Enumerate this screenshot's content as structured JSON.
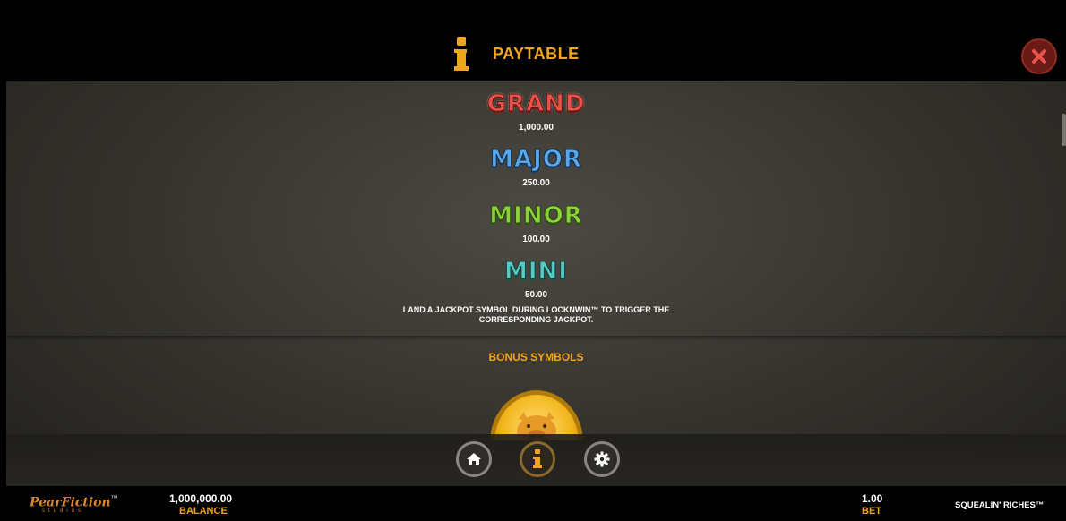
{
  "top_menu_icon": "ellipsis-icon",
  "header": {
    "title": "PAYTABLE",
    "info_icon": "info-icon",
    "close_icon": "close-icon"
  },
  "jackpots": [
    {
      "name": "GRAND",
      "value": "1,000.00",
      "color": "#e8524a"
    },
    {
      "name": "MAJOR",
      "value": "250.00",
      "color": "#5aa7e8"
    },
    {
      "name": "MINOR",
      "value": "100.00",
      "color": "#8fd13a"
    },
    {
      "name": "MINI",
      "value": "50.00",
      "color": "#55c9c3"
    }
  ],
  "description": {
    "line1": "LAND A JACKPOT SYMBOL DURING LOCKNWIN™ TO TRIGGER THE",
    "line2": "CORRESPONDING JACKPOT."
  },
  "bonus_title": "BONUS SYMBOLS",
  "nav": {
    "home_icon": "home-icon",
    "info_icon": "info-icon",
    "settings_icon": "gear-icon"
  },
  "footer": {
    "logo_main": "PearFiction",
    "logo_tm": "™",
    "logo_sub": "studios",
    "balance_value": "1,000,000.00",
    "balance_label": "BALANCE",
    "bet_value": "1.00",
    "bet_label": "BET",
    "game_name": "SQUEALIN' RICHES™"
  },
  "colors": {
    "accent": "#f0a51e",
    "close_bg": "#6b1b16"
  }
}
